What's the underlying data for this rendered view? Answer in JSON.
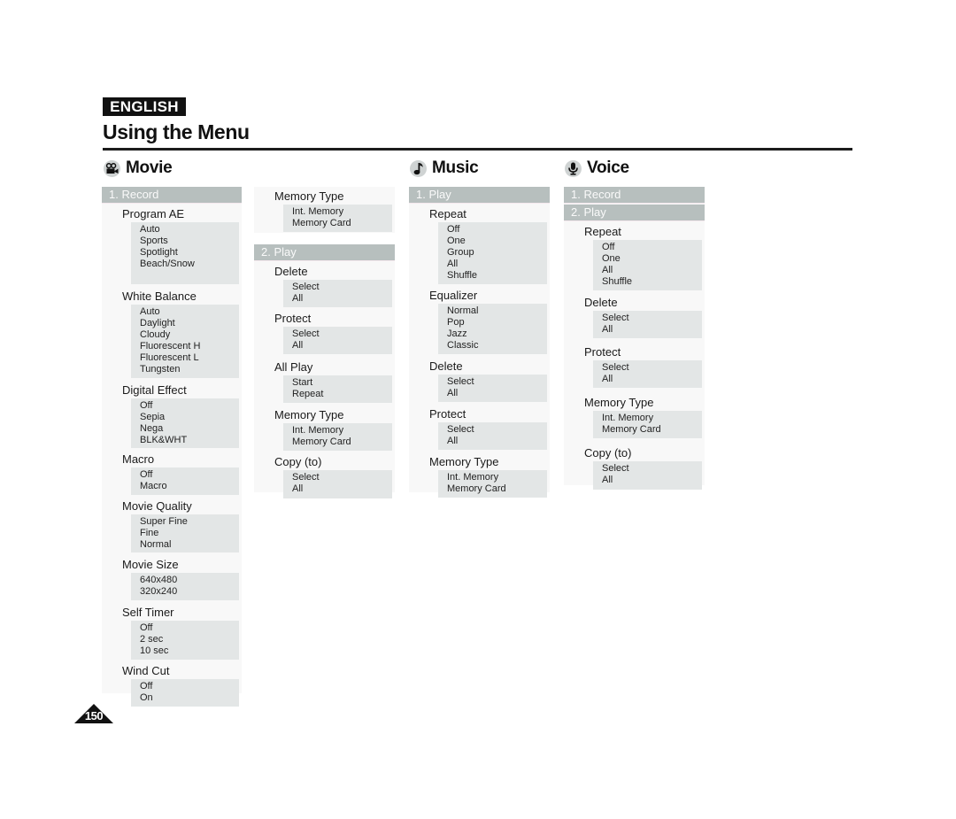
{
  "header": {
    "language": "ENGLISH",
    "title": "Using the Menu"
  },
  "sections": {
    "movie": {
      "title": "Movie",
      "icon": "video-camera-icon"
    },
    "music": {
      "title": "Music",
      "icon": "music-note-icon"
    },
    "voice": {
      "title": "Voice",
      "icon": "microphone-icon"
    }
  },
  "movie": {
    "record": {
      "label": "1. Record",
      "groups": [
        {
          "label": "Program AE",
          "options": [
            "Auto",
            "Sports",
            "Spotlight",
            "Beach/Snow"
          ]
        },
        {
          "label": "White Balance",
          "options": [
            "Auto",
            "Daylight",
            "Cloudy",
            "Fluorescent H",
            "Fluorescent L",
            "Tungsten"
          ]
        },
        {
          "label": "Digital Effect",
          "options": [
            "Off",
            "Sepia",
            "Nega",
            "BLK&WHT"
          ]
        },
        {
          "label": "Macro",
          "options": [
            "Off",
            "Macro"
          ]
        },
        {
          "label": "Movie Quality",
          "options": [
            "Super Fine",
            "Fine",
            "Normal"
          ]
        },
        {
          "label": "Movie Size",
          "options": [
            "640x480",
            "320x240"
          ]
        },
        {
          "label": "Self Timer",
          "options": [
            "Off",
            "2 sec",
            "10 sec"
          ]
        },
        {
          "label": "Wind Cut",
          "options": [
            "Off",
            "On"
          ]
        },
        {
          "label": "Memory Type",
          "options": [
            "Int. Memory",
            "Memory Card"
          ]
        }
      ]
    },
    "play": {
      "label": "2. Play",
      "groups": [
        {
          "label": "Delete",
          "options": [
            "Select",
            "All"
          ]
        },
        {
          "label": "Protect",
          "options": [
            "Select",
            "All"
          ]
        },
        {
          "label": "All Play",
          "options": [
            "Start",
            "Repeat"
          ]
        },
        {
          "label": "Memory Type",
          "options": [
            "Int. Memory",
            "Memory Card"
          ]
        },
        {
          "label": "Copy (to)",
          "options": [
            "Select",
            "All"
          ]
        }
      ]
    }
  },
  "music": {
    "play": {
      "label": "1. Play",
      "groups": [
        {
          "label": "Repeat",
          "options": [
            "Off",
            "One",
            "Group",
            "All",
            "Shuffle"
          ]
        },
        {
          "label": "Equalizer",
          "options": [
            "Normal",
            "Pop",
            "Jazz",
            "Classic"
          ]
        },
        {
          "label": "Delete",
          "options": [
            "Select",
            "All"
          ]
        },
        {
          "label": "Protect",
          "options": [
            "Select",
            "All"
          ]
        },
        {
          "label": "Memory Type",
          "options": [
            "Int. Memory",
            "Memory Card"
          ]
        }
      ]
    }
  },
  "voice": {
    "record": {
      "label": "1. Record"
    },
    "play": {
      "label": "2. Play",
      "groups": [
        {
          "label": "Repeat",
          "options": [
            "Off",
            "One",
            "All",
            "Shuffle"
          ]
        },
        {
          "label": "Delete",
          "options": [
            "Select",
            "All"
          ]
        },
        {
          "label": "Protect",
          "options": [
            "Select",
            "All"
          ]
        },
        {
          "label": "Memory Type",
          "options": [
            "Int. Memory",
            "Memory Card"
          ]
        },
        {
          "label": "Copy (to)",
          "options": [
            "Select",
            "All"
          ]
        }
      ]
    }
  },
  "footer": {
    "page_number": "150"
  }
}
